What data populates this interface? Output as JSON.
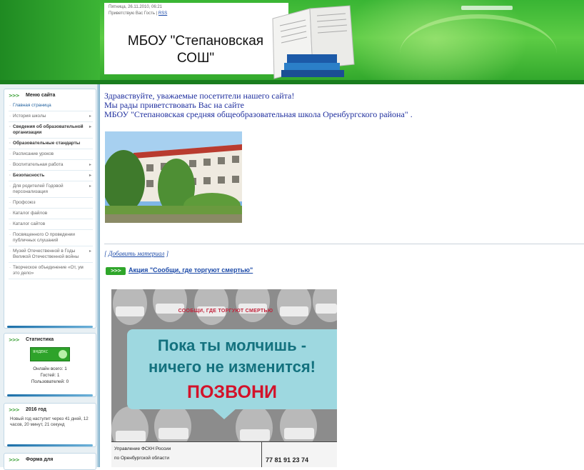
{
  "header": {
    "meta_date": "Пятница, 26.11.2010, 06:21",
    "meta_greeting": "Приветствую Вас Гость",
    "rss_label": "RSS",
    "school_title": "МБОУ \"Степановская СОШ\""
  },
  "sidebar": {
    "menu_title": "Меню сайта",
    "menu_items": [
      {
        "label": "Главная страница",
        "active": true,
        "submenu": false
      },
      {
        "label": "История школы",
        "active": false,
        "submenu": true
      },
      {
        "label": "Сведения об образовательной организации",
        "active": false,
        "submenu": true,
        "bold": true
      },
      {
        "label": "Образовательные стандарты",
        "active": false,
        "submenu": false,
        "bold": true
      },
      {
        "label": "Расписание уроков",
        "active": false,
        "submenu": false
      },
      {
        "label": "Воспитательная работа",
        "active": false,
        "submenu": true
      },
      {
        "label": "Безопасность",
        "active": false,
        "submenu": true,
        "bold": true
      },
      {
        "label": "Для родителей Годовой персонализация",
        "active": false,
        "submenu": true
      },
      {
        "label": "Профсоюз",
        "active": false,
        "submenu": false
      },
      {
        "label": "Каталог файлов",
        "active": false,
        "submenu": false
      },
      {
        "label": "Каталог сайтов",
        "active": false,
        "submenu": false
      },
      {
        "label": "Посвященного О проведении публичных слушаний",
        "active": false,
        "submenu": false
      },
      {
        "label": "Музей Отечественной в Годы Великой Отечественной войны",
        "active": false,
        "submenu": true
      },
      {
        "label": "Творческое объединение «От, ум это дело»",
        "active": false,
        "submenu": false
      }
    ],
    "stats_title": "Статистика",
    "counter_label": "ЯНДЕКС",
    "stats_online": "Онлайн всего: 1",
    "stats_guests": "Гостей: 1",
    "stats_users": "Пользователей: 0",
    "year_title": "2016 год",
    "year_text": "Новый год наступит через 41 дней, 12 часов, 20 минут, 21 секунд",
    "form_title": "Форма для"
  },
  "content": {
    "welcome_line1": "Здравствуйте, уважаемые посетители нашего сайта!",
    "welcome_line2": "Мы рады приветствовать Вас на сайте",
    "welcome_line3": "МБОУ \"Степановская средняя общеобразовательная школа Оренбургского района\" .",
    "add_comment_prefix": "[ ",
    "add_comment_link": "Добавить материал",
    "add_comment_suffix": " ]",
    "promo_arrows": ">>>",
    "promo_link": "Акция \"Сообщи, где торгуют смертью\"",
    "poster_slogan": "СООБЩИ, ГДЕ ТОРГУЮТ СМЕРТЬЮ",
    "poster_line1": "Пока ты молчишь -",
    "poster_line2": "ничего не изменится!",
    "poster_line3": "ПОЗВОНИ",
    "poster_info1": "Управление ФСКН России",
    "poster_info2": "по Оренбургской области",
    "poster_phone": "77 81 91 23 74"
  },
  "colors": {
    "header_green": "#39b534",
    "link_blue": "#1f2f9e",
    "poster_teal": "#9ed8e0",
    "poster_red": "#d3122a"
  }
}
